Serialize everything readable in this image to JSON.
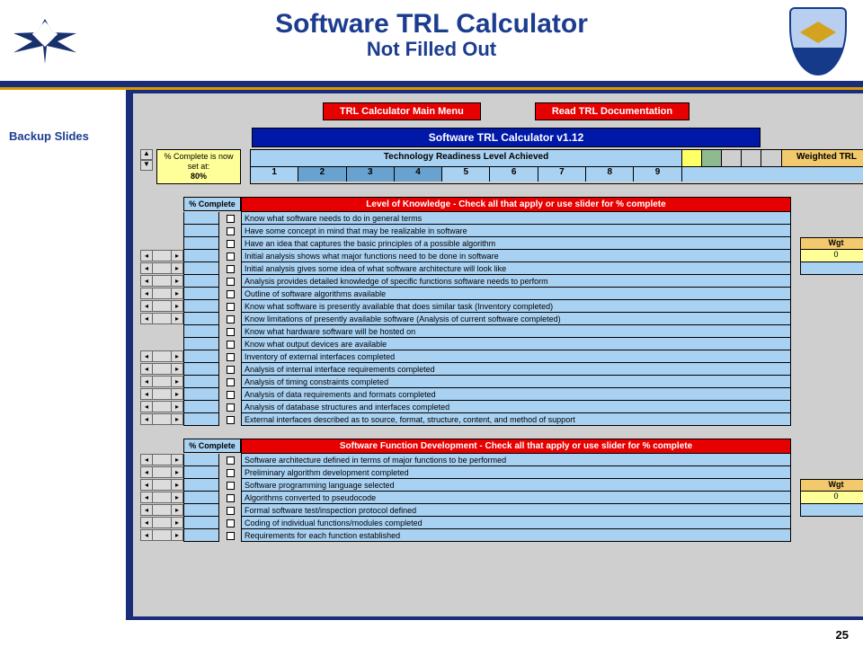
{
  "header": {
    "title": "Software TRL Calculator",
    "subtitle": "Not Filled Out"
  },
  "sidebar": {
    "label": "Backup Slides"
  },
  "buttons": {
    "main_menu": "TRL Calculator Main Menu",
    "docs": "Read TRL Documentation"
  },
  "calc_title": "Software TRL Calculator v1.12",
  "completion": {
    "prefix": "% Complete is now set at:",
    "value": "80%"
  },
  "trl_header": {
    "left": "Technology Readiness Level Achieved",
    "weighted": "Weighted TRL",
    "numbers": [
      "1",
      "2",
      "3",
      "4",
      "5",
      "6",
      "7",
      "8",
      "9"
    ]
  },
  "pct_header": "% Complete",
  "section1": {
    "header": "Level of Knowledge - Check all that apply or use slider for % complete",
    "wgt_header": "Wgt",
    "wgt_value": "0",
    "items": [
      {
        "has_slider": false,
        "text": "Know what software needs to do in general terms"
      },
      {
        "has_slider": false,
        "text": "Have some concept in mind that may be realizable in software"
      },
      {
        "has_slider": false,
        "text": "Have an idea that captures the basic principles of a possible algorithm"
      },
      {
        "has_slider": true,
        "text": "Initial analysis shows what major functions need to be done in software"
      },
      {
        "has_slider": true,
        "text": "Initial analysis gives some idea of what software architecture will look like"
      },
      {
        "has_slider": true,
        "text": "Analysis provides detailed knowledge of specific functions software needs to perform"
      },
      {
        "has_slider": true,
        "text": "Outline of software algorithms available"
      },
      {
        "has_slider": true,
        "text": "Know what software is presently available that does similar task (Inventory completed)"
      },
      {
        "has_slider": true,
        "text": "Know limitations of presently available software (Analysis of current software completed)"
      },
      {
        "has_slider": false,
        "text": "Know what hardware software will be hosted on"
      },
      {
        "has_slider": false,
        "text": "Know what output devices are available"
      },
      {
        "has_slider": true,
        "text": "Inventory of external interfaces completed"
      },
      {
        "has_slider": true,
        "text": "Analysis of internal interface requirements completed"
      },
      {
        "has_slider": true,
        "text": "Analysis of timing constraints completed"
      },
      {
        "has_slider": true,
        "text": "Analysis of data requirements and formats completed"
      },
      {
        "has_slider": true,
        "text": "Analysis of database structures and interfaces completed"
      },
      {
        "has_slider": true,
        "text": "External interfaces described as to source, format, structure, content, and method of support"
      }
    ]
  },
  "section2": {
    "header": "Software Function Development - Check all that apply or use slider for % complete",
    "wgt_header": "Wgt",
    "wgt_value": "0",
    "items": [
      {
        "has_slider": true,
        "text": "Software architecture defined in terms of major functions to be performed"
      },
      {
        "has_slider": true,
        "text": "Preliminary algorithm development completed"
      },
      {
        "has_slider": true,
        "text": "Software programming language selected"
      },
      {
        "has_slider": true,
        "text": "Algorithms converted to pseudocode"
      },
      {
        "has_slider": true,
        "text": "Formal software test/inspection protocol defined"
      },
      {
        "has_slider": true,
        "text": "Coding of individual functions/modules completed"
      },
      {
        "has_slider": true,
        "text": "Requirements for each function established"
      }
    ]
  },
  "page_number": "25"
}
